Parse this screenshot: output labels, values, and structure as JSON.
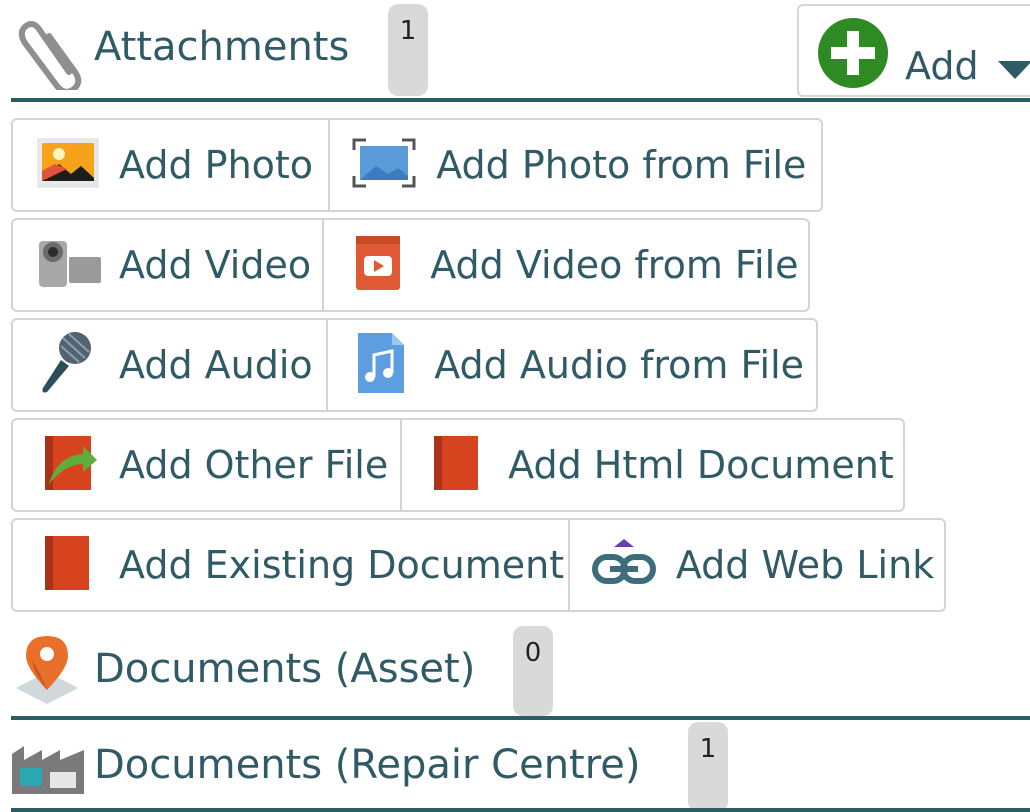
{
  "attachments": {
    "title": "Attachments",
    "count": "1",
    "add_button_label": "Add"
  },
  "buttons": {
    "add_photo": "Add Photo",
    "add_photo_from_file": "Add Photo from File",
    "add_video": "Add Video",
    "add_video_from_file": "Add Video from File",
    "add_audio": "Add Audio",
    "add_audio_from_file": "Add Audio from File",
    "add_other_file": "Add Other File",
    "add_html_document": "Add Html Document",
    "add_existing_document": "Add Existing Document",
    "add_web_link": "Add Web Link"
  },
  "documents_asset": {
    "title": "Documents (Asset)",
    "count": "0"
  },
  "documents_repair_centre": {
    "title": "Documents (Repair Centre)",
    "count": "1"
  },
  "colors": {
    "heading": "#2f5a66",
    "rule": "#2d5b66",
    "add_plus": "#2e8b24",
    "badge": "#d9d9d9"
  },
  "icons": [
    "paperclip-icon",
    "plus-circle-icon",
    "caret-down-icon",
    "photo-icon",
    "photo-frame-icon",
    "video-camera-icon",
    "video-file-icon",
    "microphone-icon",
    "audio-file-icon",
    "other-file-icon",
    "html-document-icon",
    "existing-document-icon",
    "web-link-icon",
    "map-pin-icon",
    "factory-icon"
  ]
}
